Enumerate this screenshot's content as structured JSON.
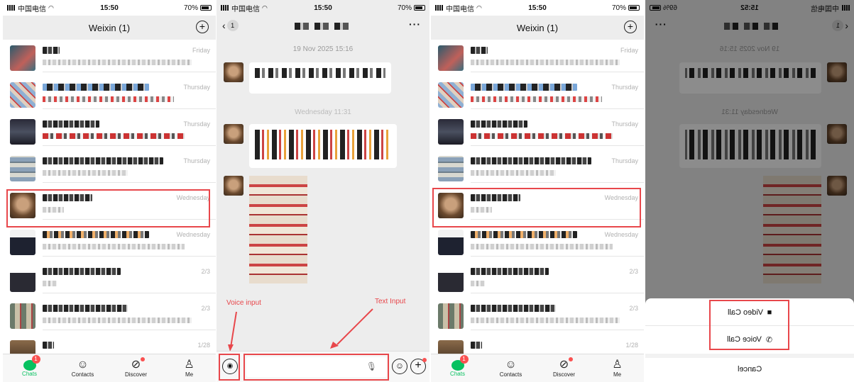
{
  "status": {
    "carrier": "中国电信",
    "time": "15:50",
    "battery": "70%",
    "time_p4": "15:52",
    "battery_p4": "69%"
  },
  "chat_list": {
    "title": "Weixin (1)",
    "rows": [
      {
        "time": "Friday"
      },
      {
        "time": "Thursday"
      },
      {
        "time": "Thursday"
      },
      {
        "time": "Thursday"
      },
      {
        "time": "Wednesday"
      },
      {
        "time": "Wednesday"
      },
      {
        "time": "2/3"
      },
      {
        "time": "2/3"
      },
      {
        "time": "1/28"
      }
    ]
  },
  "tabs": {
    "chats": "Chats",
    "contacts": "Contacts",
    "discover": "Discover",
    "me": "Me",
    "unread": "1"
  },
  "chat_screen": {
    "back_count": "1",
    "more": "···",
    "date1": "19 Nov 2025 15:16",
    "date2": "Wednesday 11:31"
  },
  "annotations": {
    "voice_input": "Voice input",
    "text_input": "Text Input"
  },
  "call_sheet": {
    "video_call": "Video Call",
    "voice_call": "Voice Call",
    "cancel": "Cancel"
  },
  "colors": {
    "accent": "#07c160",
    "highlight": "#e8474b",
    "badge": "#fa5151"
  }
}
